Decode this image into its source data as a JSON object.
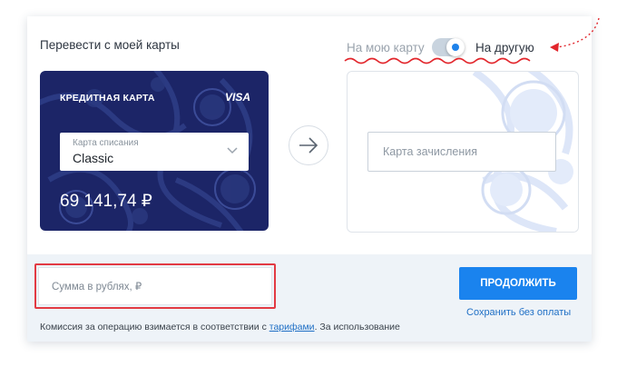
{
  "form": {
    "title": "Перевести с моей карты",
    "toggle_left": "На мою карту",
    "toggle_right": "На другую",
    "toggle_on": true
  },
  "source_card": {
    "type": "КРЕДИТНАЯ КАРТА",
    "brand": "VISA",
    "select_label": "Карта списания",
    "select_value": "Classic",
    "balance": "69 141,74 ₽"
  },
  "destination_card": {
    "placeholder": "Карта зачисления"
  },
  "amount": {
    "placeholder": "Сумма в рублях,  ₽"
  },
  "actions": {
    "continue_label": "ПРОДОЛЖИТЬ",
    "save_label": "Сохранить без оплаты"
  },
  "commission": {
    "text_before": "Комиссия за операцию взимается в соответствии с ",
    "link": "тарифами",
    "text_after": ". За использование"
  },
  "colors": {
    "accent": "#1a83ee",
    "card_bg": "#1c2567",
    "highlight": "#e23a43"
  }
}
